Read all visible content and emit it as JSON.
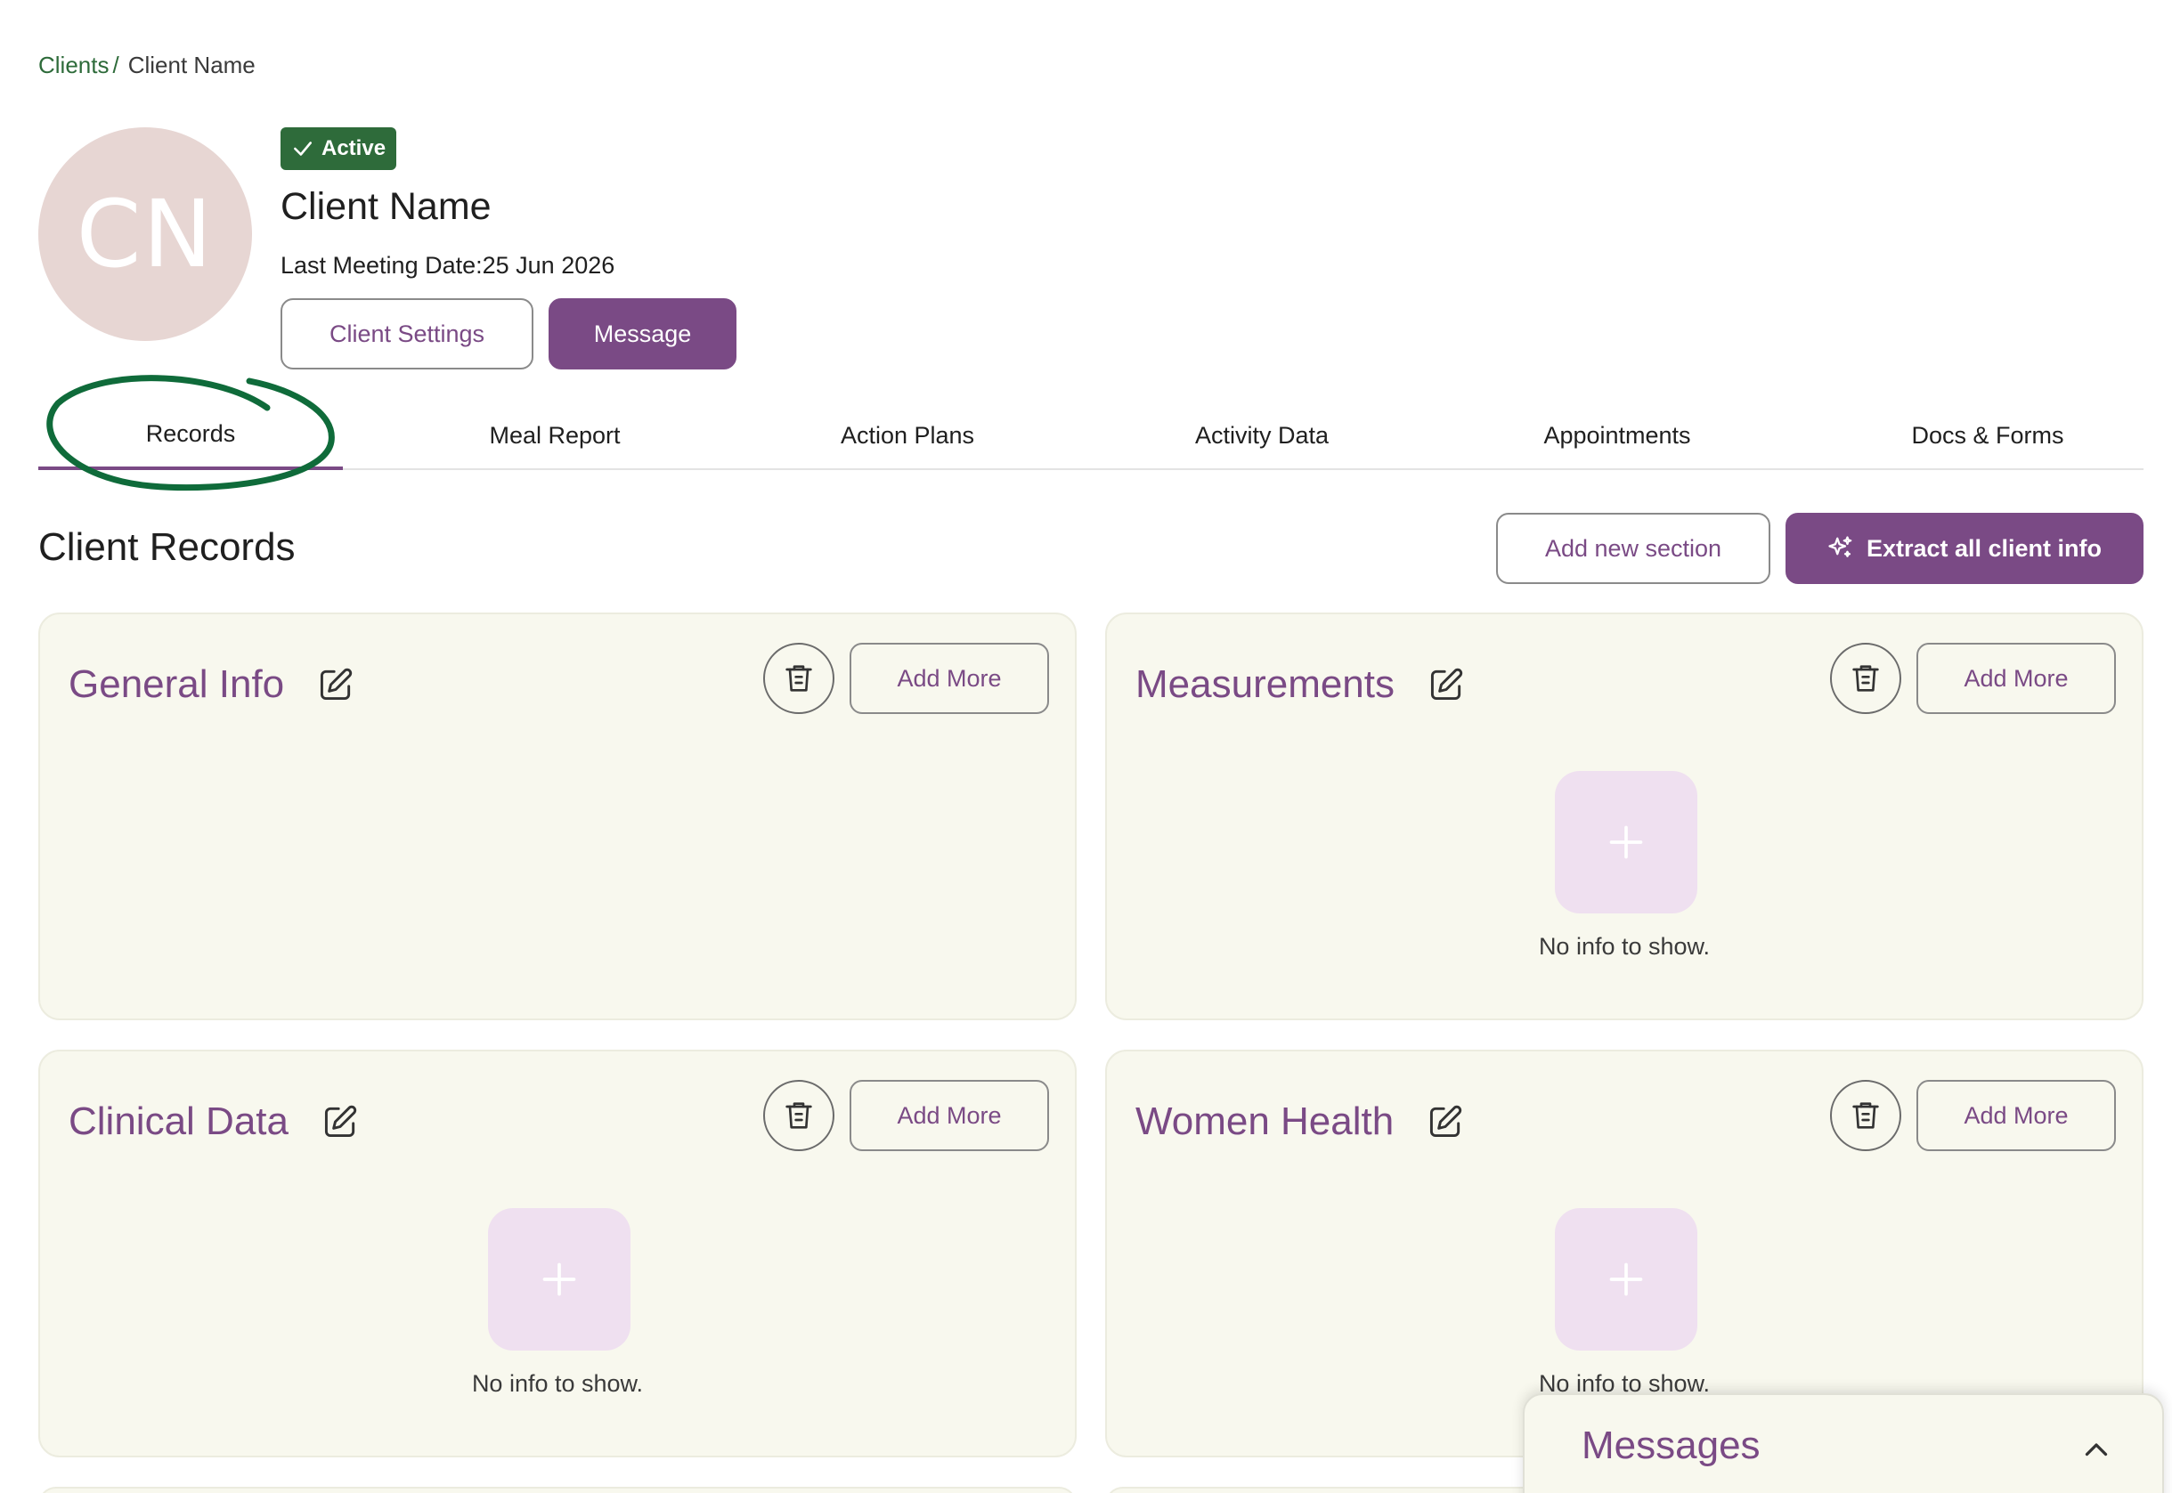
{
  "breadcrumb": {
    "parent": "Clients",
    "separator": "/",
    "current": "Client Name"
  },
  "client": {
    "initials": "CN",
    "status": "Active",
    "name": "Client Name",
    "last_meeting": "Last Meeting Date:25 Jun 2026"
  },
  "actions": {
    "settings_label": "Client Settings",
    "message_label": "Message"
  },
  "tabs": [
    {
      "label": "Records",
      "active": true
    },
    {
      "label": "Meal Report"
    },
    {
      "label": "Action Plans"
    },
    {
      "label": "Activity Data"
    },
    {
      "label": "Appointments"
    },
    {
      "label": "Docs & Forms"
    }
  ],
  "records": {
    "title": "Client Records",
    "add_section_label": "Add new section",
    "extract_label": "Extract all client info",
    "add_more_label": "Add More",
    "empty_text": "No info to show.",
    "cards": [
      {
        "title": "General Info",
        "empty": false
      },
      {
        "title": "Measurements",
        "empty": true
      },
      {
        "title": "Clinical Data",
        "empty": true
      },
      {
        "title": "Women Health",
        "empty": true
      }
    ]
  },
  "messages": {
    "title": "Messages"
  },
  "colors": {
    "accent": "#7a4a85",
    "brand_green": "#2e6b3a",
    "card_bg": "#f8f8ee",
    "empty_tile": "#efe0f0",
    "annotation": "#0f6b3a"
  },
  "icons": {
    "status": "check-icon",
    "extract": "sparkle-icon",
    "edit": "edit-icon",
    "delete": "trash-icon",
    "empty": "plus-icon",
    "collapse": "chevron-up-icon"
  }
}
